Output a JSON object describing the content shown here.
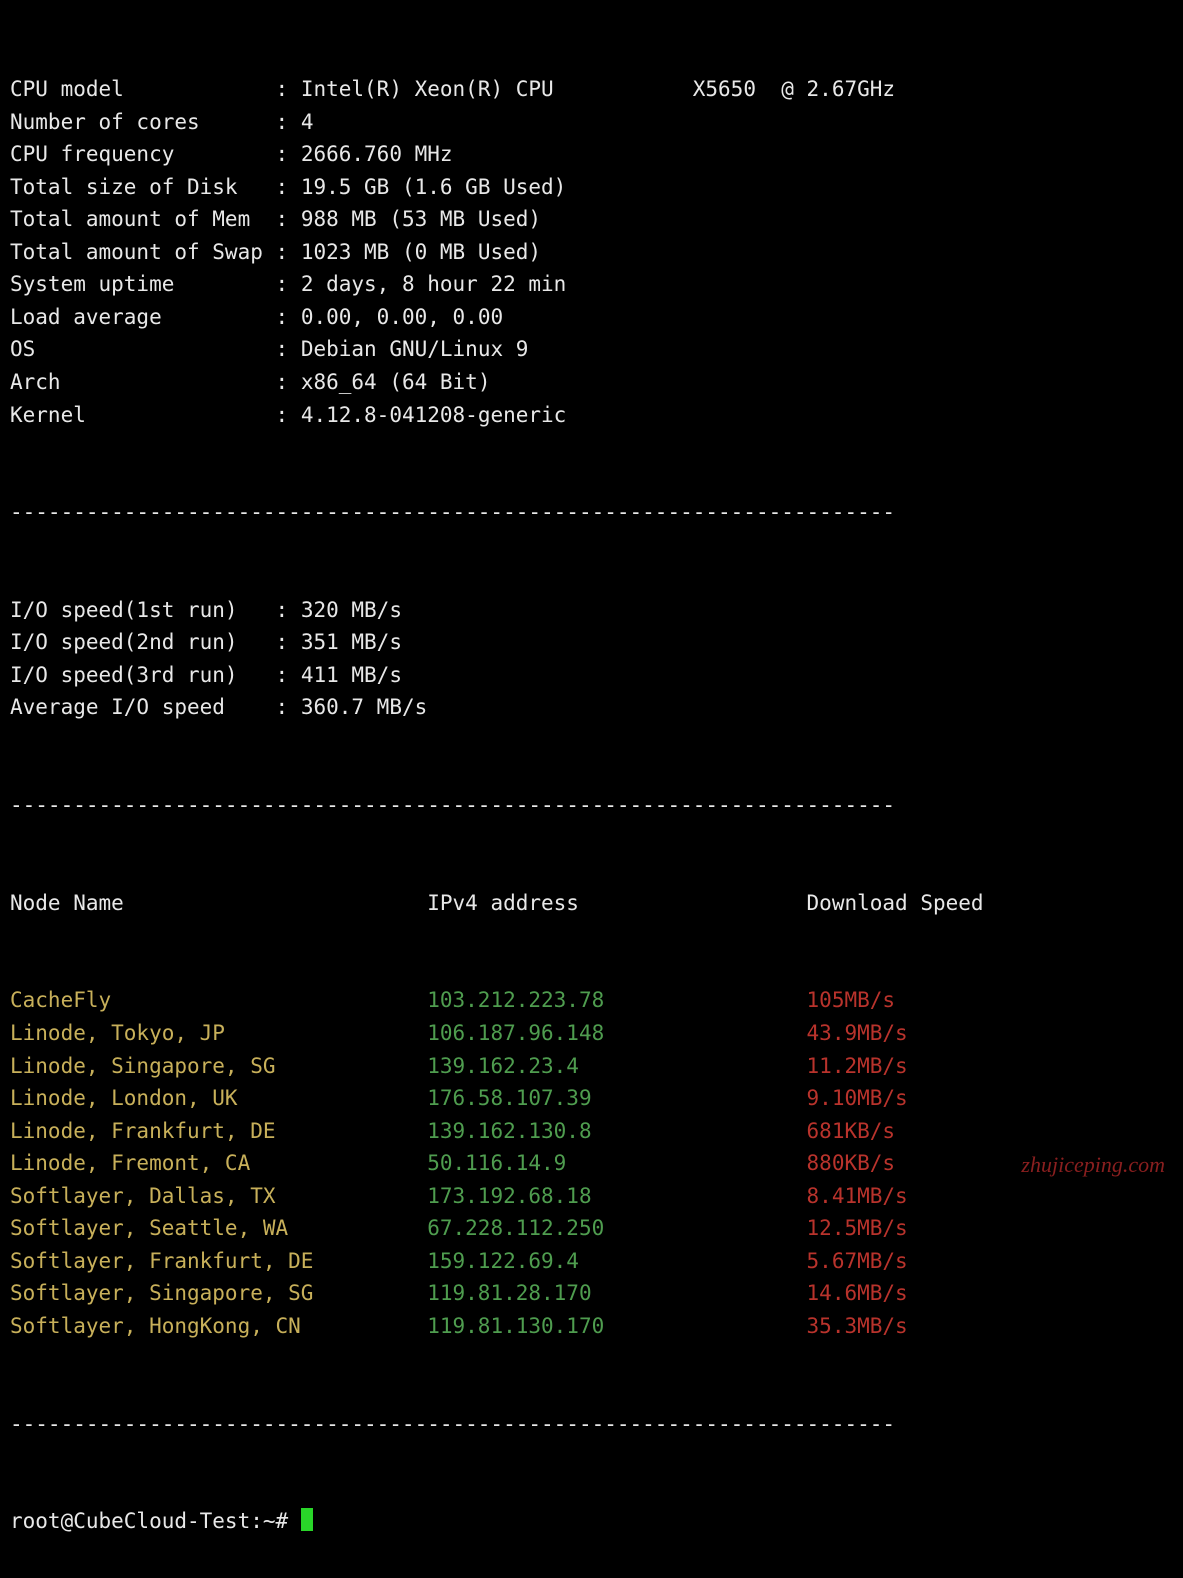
{
  "sysinfo": [
    {
      "label": "CPU model",
      "value": "Intel(R) Xeon(R) CPU           X5650  @ 2.67GHz"
    },
    {
      "label": "Number of cores",
      "value": "4"
    },
    {
      "label": "CPU frequency",
      "value": "2666.760 MHz"
    },
    {
      "label": "Total size of Disk",
      "value": "19.5 GB (1.6 GB Used)"
    },
    {
      "label": "Total amount of Mem",
      "value": "988 MB (53 MB Used)"
    },
    {
      "label": "Total amount of Swap",
      "value": "1023 MB (0 MB Used)"
    },
    {
      "label": "System uptime",
      "value": "2 days, 8 hour 22 min"
    },
    {
      "label": "Load average",
      "value": "0.00, 0.00, 0.00"
    },
    {
      "label": "OS",
      "value": "Debian GNU/Linux 9"
    },
    {
      "label": "Arch",
      "value": "x86_64 (64 Bit)"
    },
    {
      "label": "Kernel",
      "value": "4.12.8-041208-generic"
    }
  ],
  "io": [
    {
      "label": "I/O speed(1st run)",
      "value": "320 MB/s"
    },
    {
      "label": "I/O speed(2nd run)",
      "value": "351 MB/s"
    },
    {
      "label": "I/O speed(3rd run)",
      "value": "411 MB/s"
    },
    {
      "label": "Average I/O speed",
      "value": "360.7 MB/s"
    }
  ],
  "net_header": {
    "name": "Node Name",
    "ip": "IPv4 address",
    "speed": "Download Speed"
  },
  "net": [
    {
      "name": "CacheFly",
      "ip": "103.212.223.78",
      "speed": "105MB/s"
    },
    {
      "name": "Linode, Tokyo, JP",
      "ip": "106.187.96.148",
      "speed": "43.9MB/s"
    },
    {
      "name": "Linode, Singapore, SG",
      "ip": "139.162.23.4",
      "speed": "11.2MB/s"
    },
    {
      "name": "Linode, London, UK",
      "ip": "176.58.107.39",
      "speed": "9.10MB/s"
    },
    {
      "name": "Linode, Frankfurt, DE",
      "ip": "139.162.130.8",
      "speed": "681KB/s"
    },
    {
      "name": "Linode, Fremont, CA",
      "ip": "50.116.14.9",
      "speed": "880KB/s"
    },
    {
      "name": "Softlayer, Dallas, TX",
      "ip": "173.192.68.18",
      "speed": "8.41MB/s"
    },
    {
      "name": "Softlayer, Seattle, WA",
      "ip": "67.228.112.250",
      "speed": "12.5MB/s"
    },
    {
      "name": "Softlayer, Frankfurt, DE",
      "ip": "159.122.69.4",
      "speed": "5.67MB/s"
    },
    {
      "name": "Softlayer, Singapore, SG",
      "ip": "119.81.28.170",
      "speed": "14.6MB/s"
    },
    {
      "name": "Softlayer, HongKong, CN",
      "ip": "119.81.130.170",
      "speed": "35.3MB/s"
    }
  ],
  "prompt": "root@CubeCloud-Test:~# ",
  "watermark": "zhujiceping.com",
  "divider": "----------------------------------------------------------------------",
  "layout": {
    "label_width": 20,
    "sep": " : ",
    "net_name_w": 33,
    "net_ip_w": 30
  }
}
